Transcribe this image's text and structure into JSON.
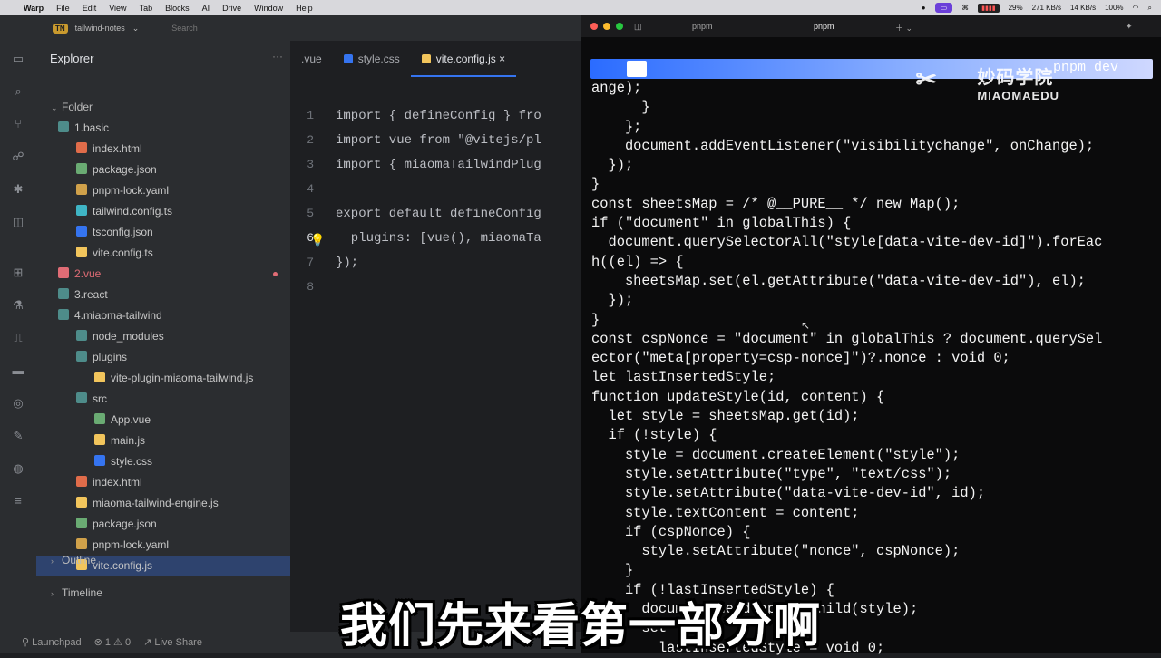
{
  "menubar": {
    "app": "Warp",
    "items": [
      "File",
      "Edit",
      "View",
      "Tab",
      "Blocks",
      "AI",
      "Drive",
      "Window",
      "Help"
    ],
    "battery": "100%",
    "memory": "29%",
    "net_up": "271 KB/s",
    "net_down": "14 KB/s"
  },
  "editor": {
    "project_badge": "TN",
    "project_name": "tailwind-notes",
    "search_placeholder": "Search",
    "explorer_title": "Explorer",
    "tree": [
      {
        "label": "Folder",
        "kind": "section"
      },
      {
        "label": "1.basic",
        "kind": "folder"
      },
      {
        "label": "index.html",
        "kind": "file",
        "color": "#e06c4a"
      },
      {
        "label": "package.json",
        "kind": "file",
        "color": "#6aab73"
      },
      {
        "label": "pnpm-lock.yaml",
        "kind": "file",
        "color": "#d0a14a"
      },
      {
        "label": "tailwind.config.ts",
        "kind": "file",
        "color": "#3fb5c5"
      },
      {
        "label": "tsconfig.json",
        "kind": "file",
        "color": "#3574f0"
      },
      {
        "label": "vite.config.ts",
        "kind": "file",
        "color": "#f2c55c"
      },
      {
        "label": "2.vue",
        "kind": "folder",
        "color": "#e06c75"
      },
      {
        "label": "3.react",
        "kind": "folder"
      },
      {
        "label": "4.miaoma-tailwind",
        "kind": "folder"
      },
      {
        "label": "node_modules",
        "kind": "folder"
      },
      {
        "label": "plugins",
        "kind": "folder"
      },
      {
        "label": "vite-plugin-miaoma-tailwind.js",
        "kind": "file",
        "color": "#f2c55c"
      },
      {
        "label": "src",
        "kind": "folder"
      },
      {
        "label": "App.vue",
        "kind": "file",
        "color": "#6aab73"
      },
      {
        "label": "main.js",
        "kind": "file",
        "color": "#f2c55c"
      },
      {
        "label": "style.css",
        "kind": "file",
        "color": "#3574f0"
      },
      {
        "label": "index.html",
        "kind": "file",
        "color": "#e06c4a"
      },
      {
        "label": "miaoma-tailwind-engine.js",
        "kind": "file",
        "color": "#f2c55c"
      },
      {
        "label": "package.json",
        "kind": "file",
        "color": "#6aab73"
      },
      {
        "label": "pnpm-lock.yaml",
        "kind": "file",
        "color": "#d0a14a"
      },
      {
        "label": "vite.config.js",
        "kind": "file",
        "color": "#f2c55c"
      }
    ],
    "outline": "Outline",
    "timeline": "Timeline",
    "tabs": [
      {
        "label": ".vue",
        "active": false
      },
      {
        "label": "style.css",
        "active": false
      },
      {
        "label": "vite.config.js",
        "active": true
      }
    ],
    "tab_close": "×",
    "code_lines": [
      {
        "n": "1",
        "text": "import { defineConfig } fro"
      },
      {
        "n": "2",
        "text": "import vue from \"@vitejs/pl"
      },
      {
        "n": "3",
        "text": "import { miaomaTailwindPlug"
      },
      {
        "n": "4",
        "text": ""
      },
      {
        "n": "5",
        "text": "export default defineConfig"
      },
      {
        "n": "6",
        "text": "  plugins: [vue(), miaomaTa"
      },
      {
        "n": "7",
        "text": "});"
      },
      {
        "n": "8",
        "text": ""
      }
    ],
    "status": {
      "launchpad": "Launchpad",
      "errors": "1",
      "warnings": "0",
      "live_share": "Live Share"
    }
  },
  "terminal": {
    "tabs": [
      "pnpm",
      "pnpm"
    ],
    "command": "pnpm dev",
    "watermark_cn": "妙码学院",
    "watermark_en": "MIAOMAEDU",
    "lines": [
      "ange);",
      "      }",
      "    };",
      "    document.addEventListener(\"visibilitychange\", onChange);",
      "  });",
      "}",
      "const sheetsMap = /* @__PURE__ */ new Map();",
      "if (\"document\" in globalThis) {",
      "  document.querySelectorAll(\"style[data-vite-dev-id]\").forEac",
      "h((el) => {",
      "    sheetsMap.set(el.getAttribute(\"data-vite-dev-id\"), el);",
      "  });",
      "}",
      "const cspNonce = \"document\" in globalThis ? document.querySel",
      "ector(\"meta[property=csp-nonce]\")?.nonce : void 0;",
      "let lastInsertedStyle;",
      "function updateStyle(id, content) {",
      "  let style = sheetsMap.get(id);",
      "  if (!style) {",
      "    style = document.createElement(\"style\");",
      "    style.setAttribute(\"type\", \"text/css\");",
      "    style.setAttribute(\"data-vite-dev-id\", id);",
      "    style.textContent = content;",
      "    if (cspNonce) {",
      "      style.setAttribute(\"nonce\", cspNonce);",
      "    }",
      "    if (!lastInsertedStyle) {",
      "      document.head.appendChild(style);",
      "      set",
      "        lastInsertedStyle = void 0;"
    ]
  },
  "subtitle": "我们先来看第一部分啊"
}
